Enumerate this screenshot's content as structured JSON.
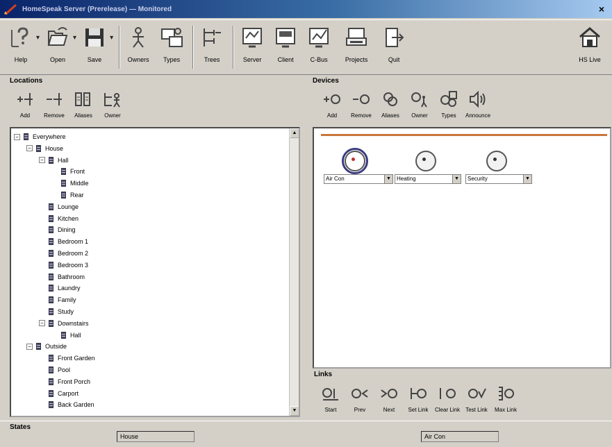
{
  "window": {
    "title": "HomeSpeak Server (Prerelease) — Monitored",
    "close_glyph": "×"
  },
  "toolbar": [
    {
      "label": "Help",
      "icon": "help-icon"
    },
    {
      "label": "Open",
      "icon": "open-icon"
    },
    {
      "label": "Save",
      "icon": "save-icon"
    },
    {
      "label": "Owners",
      "icon": "owners-icon"
    },
    {
      "label": "Types",
      "icon": "types-icon"
    },
    {
      "label": "Trees",
      "icon": "trees-icon"
    },
    {
      "label": "Server",
      "icon": "server-icon"
    },
    {
      "label": "Client",
      "icon": "client-icon"
    },
    {
      "label": "C-Bus",
      "icon": "cbus-icon"
    },
    {
      "label": "Projects",
      "icon": "projects-icon"
    },
    {
      "label": "Quit",
      "icon": "quit-icon"
    },
    {
      "label": "HS Live",
      "icon": "hslive-icon"
    }
  ],
  "dropdown_glyph": "▾",
  "locations": {
    "title": "Locations",
    "toolbar": [
      {
        "label": "Add",
        "icon": "add-location-icon"
      },
      {
        "label": "Remove",
        "icon": "remove-location-icon"
      },
      {
        "label": "Aliases",
        "icon": "aliases-icon"
      },
      {
        "label": "Owner",
        "icon": "owner-icon"
      }
    ],
    "tree": [
      {
        "label": "Everywhere",
        "depth": 0,
        "toggle": "−"
      },
      {
        "label": "House",
        "depth": 1,
        "toggle": "−"
      },
      {
        "label": "Hall",
        "depth": 2,
        "toggle": "−"
      },
      {
        "label": "Front",
        "depth": 3,
        "toggle": ""
      },
      {
        "label": "Middle",
        "depth": 3,
        "toggle": ""
      },
      {
        "label": "Rear",
        "depth": 3,
        "toggle": ""
      },
      {
        "label": "Lounge",
        "depth": 2,
        "toggle": ""
      },
      {
        "label": "Kitchen",
        "depth": 2,
        "toggle": ""
      },
      {
        "label": "Dining",
        "depth": 2,
        "toggle": ""
      },
      {
        "label": "Bedroom 1",
        "depth": 2,
        "toggle": ""
      },
      {
        "label": "Bedroom 2",
        "depth": 2,
        "toggle": ""
      },
      {
        "label": "Bedroom 3",
        "depth": 2,
        "toggle": ""
      },
      {
        "label": "Bathroom",
        "depth": 2,
        "toggle": ""
      },
      {
        "label": "Laundry",
        "depth": 2,
        "toggle": ""
      },
      {
        "label": "Family",
        "depth": 2,
        "toggle": ""
      },
      {
        "label": "Study",
        "depth": 2,
        "toggle": ""
      },
      {
        "label": "Downstairs",
        "depth": 2,
        "toggle": "−"
      },
      {
        "label": "Hall",
        "depth": 3,
        "toggle": ""
      },
      {
        "label": "Outside",
        "depth": 1,
        "toggle": "−"
      },
      {
        "label": "Front Garden",
        "depth": 2,
        "toggle": ""
      },
      {
        "label": "Pool",
        "depth": 2,
        "toggle": ""
      },
      {
        "label": "Front Porch",
        "depth": 2,
        "toggle": ""
      },
      {
        "label": "Carport",
        "depth": 2,
        "toggle": ""
      },
      {
        "label": "Back Garden",
        "depth": 2,
        "toggle": ""
      }
    ],
    "scroll_up": "▲",
    "scroll_down": "▼"
  },
  "devices": {
    "title": "Devices",
    "toolbar": [
      {
        "label": "Add",
        "icon": "add-device-icon"
      },
      {
        "label": "Remove",
        "icon": "remove-device-icon"
      },
      {
        "label": "Aliases",
        "icon": "device-aliases-icon"
      },
      {
        "label": "Owner",
        "icon": "device-owner-icon"
      },
      {
        "label": "Types",
        "icon": "device-types-icon"
      },
      {
        "label": "Announce",
        "icon": "announce-icon"
      }
    ],
    "items": [
      {
        "value": "Air Con",
        "selected": true
      },
      {
        "value": "Heating",
        "selected": false
      },
      {
        "value": "Security",
        "selected": false
      }
    ],
    "arrow": "▼"
  },
  "links": {
    "title": "Links",
    "toolbar": [
      {
        "label": "Start",
        "icon": "start-link-icon"
      },
      {
        "label": "Prev",
        "icon": "prev-link-icon"
      },
      {
        "label": "Next",
        "icon": "next-link-icon"
      },
      {
        "label": "Set Link",
        "icon": "set-link-icon"
      },
      {
        "label": "Clear Link",
        "icon": "clear-link-icon"
      },
      {
        "label": "Test Link",
        "icon": "test-link-icon"
      },
      {
        "label": "Max Link",
        "icon": "max-link-icon"
      }
    ]
  },
  "status": {
    "title": "States",
    "location": "House",
    "device": "Air Con"
  },
  "colors": {
    "accent_line": "#c9773a",
    "title_gradient_start": "#0a246a",
    "chrome": "#d4d0c8"
  }
}
